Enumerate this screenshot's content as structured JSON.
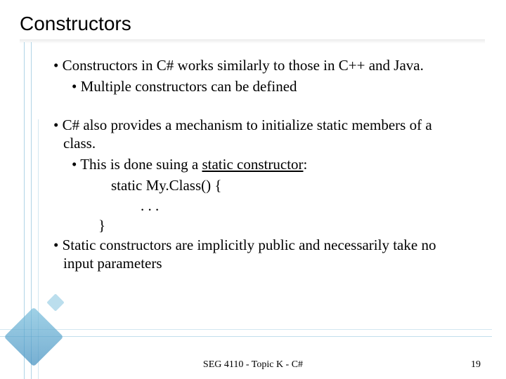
{
  "title": "Constructors",
  "bullets": {
    "b1": "Constructors in C# works similarly to those in C++ and Java.",
    "b1a": "Multiple constructors can be defined",
    "b2": "C# also provides a mechanism to  initialize static members of a class.",
    "b2a_pre": "This is done suing a ",
    "b2a_u": "static constructor",
    "b2a_post": ":",
    "code1": "static My.Class() {",
    "code2": ". . .",
    "code3": "}",
    "b3": "Static constructors are implicitly public and necessarily take no input parameters"
  },
  "footer": {
    "center": "SEG 4110 - Topic K - C#",
    "page": "19"
  }
}
